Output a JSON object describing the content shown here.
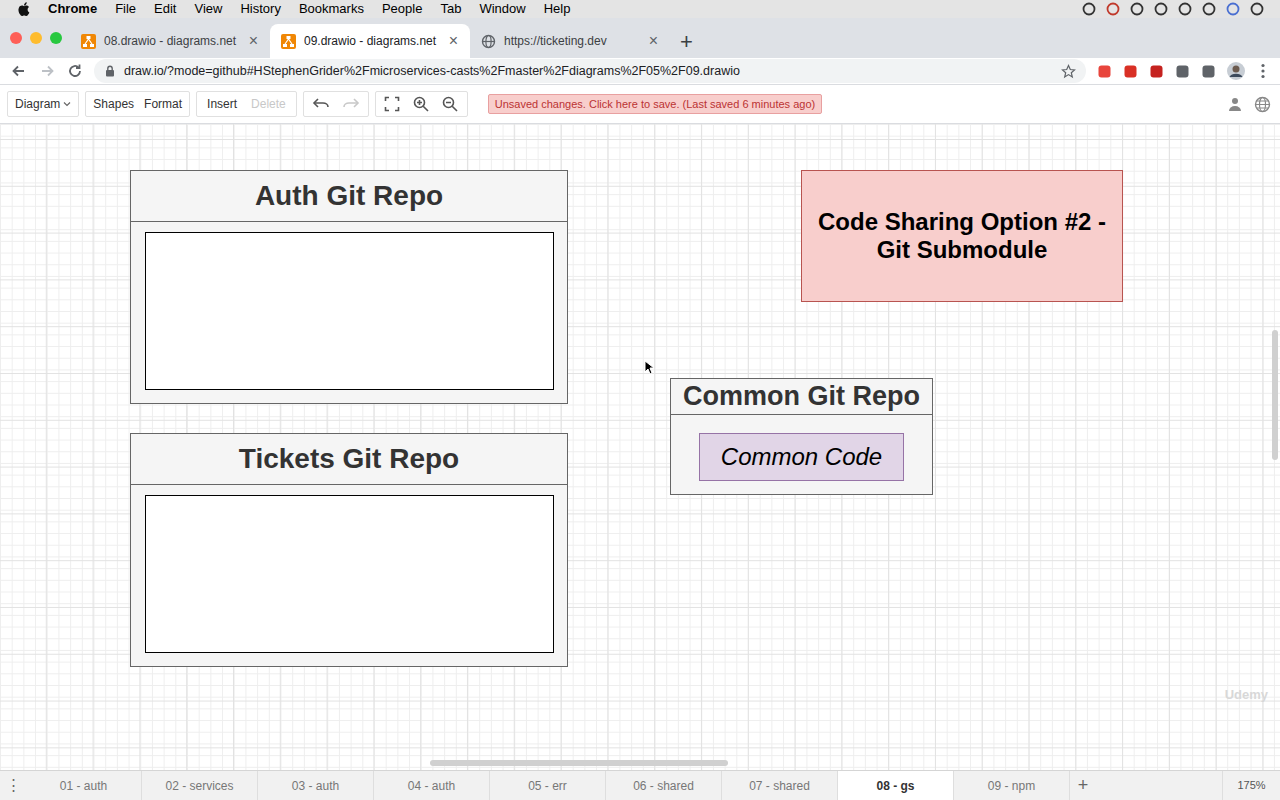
{
  "menubar": {
    "app": "Chrome",
    "items": [
      "File",
      "Edit",
      "View",
      "History",
      "Bookmarks",
      "People",
      "Tab",
      "Window",
      "Help"
    ]
  },
  "browser": {
    "tabs": [
      {
        "label": "08.drawio - diagrams.net",
        "selected": false,
        "close": "×",
        "kind": "drawio"
      },
      {
        "label": "09.drawio - diagrams.net",
        "selected": true,
        "close": "×",
        "kind": "drawio"
      },
      {
        "label": "https://ticketing.dev",
        "selected": false,
        "close": "×",
        "kind": "web"
      }
    ],
    "new_tab": "+",
    "url": "draw.io/?mode=github#HStephenGrider%2Fmicroservices-casts%2Fmaster%2Fdiagrams%2F05%2F09.drawio"
  },
  "toolbar": {
    "diagram": "Diagram",
    "shapes": "Shapes",
    "format": "Format",
    "insert": "Insert",
    "delete": {
      "label": "Delete",
      "disabled": true
    },
    "notice": "Unsaved changes. Click here to save. (Last saved 6 minutes ago)"
  },
  "diagram": {
    "containers": [
      {
        "title": "Auth Git Repo",
        "kind": "repo",
        "items": []
      },
      {
        "title": "Tickets Git Repo",
        "kind": "repo",
        "items": []
      },
      {
        "title": "Common Git Repo",
        "kind": "shared",
        "items": [
          "Common Code"
        ]
      }
    ],
    "note": "Code Sharing Option #2 - Git Submodule"
  },
  "watermark": "Udemy",
  "pages": {
    "menu": "⋮",
    "tabs": [
      {
        "label": "01 - auth",
        "selected": false
      },
      {
        "label": "02 - services",
        "selected": false
      },
      {
        "label": "03 - auth",
        "selected": false
      },
      {
        "label": "04 - auth",
        "selected": false
      },
      {
        "label": "05 - err",
        "selected": false
      },
      {
        "label": "06 - shared",
        "selected": false
      },
      {
        "label": "07 - shared",
        "selected": false
      },
      {
        "label": "08 - gs",
        "selected": true
      },
      {
        "label": "09 - npm",
        "selected": false
      }
    ],
    "add": "+",
    "zoom": "175%"
  }
}
